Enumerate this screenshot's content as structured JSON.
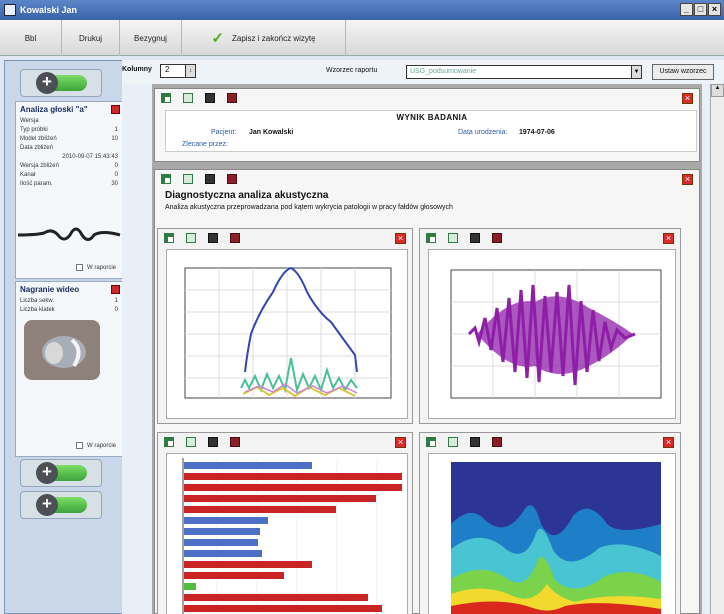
{
  "window": {
    "title": "Kowalski Jan",
    "controls": [
      "_",
      "□",
      "×"
    ]
  },
  "toolbar": {
    "close": "Bbl",
    "print": "Drukuj",
    "report": "Bezygnuj",
    "save_close": "Zapisz i zakończ wizytę"
  },
  "sidebar": {
    "analysis_card": {
      "title": "Analiza głoski \"a\"",
      "rows": [
        {
          "label": "Wersja",
          "value": ""
        },
        {
          "label": "Typ próbki",
          "value": "1"
        },
        {
          "label": "Model zbliżeń",
          "value": "10"
        },
        {
          "label": "Data zbliżeń",
          "value": ""
        },
        {
          "label": "",
          "value": "2010-09-07 15:43:43"
        },
        {
          "label": "Wersja zbliżeń",
          "value": "0"
        },
        {
          "label": "Kanał",
          "value": "0"
        },
        {
          "label": "Ilość param.",
          "value": "30"
        }
      ],
      "report_toggle": "W raporcie"
    },
    "video_card": {
      "title": "Nagranie wideo",
      "rows": [
        {
          "label": "Liczba sekw.",
          "value": "1"
        },
        {
          "label": "Liczba klatek",
          "value": "0"
        }
      ],
      "report_toggle": "W raporcie"
    }
  },
  "controls": {
    "columns_label": "Kolumny",
    "columns_value": "2",
    "template_label": "Wzorzec raportu",
    "template_value": "USG_podsumowanie",
    "set_template": "Ustaw wzorzec"
  },
  "report": {
    "title": "WYNIK BADANIA",
    "patient_label": "Pacjent:",
    "patient_value": "Jan Kowalski",
    "birth_label": "Data urodzenia:",
    "birth_value": "1974-07-06",
    "ordered_by_label": "Zlecane przez:"
  },
  "diagnostics": {
    "title": "Diagnostyczna analiza akustyczna",
    "description": "Analiza akustyczna przeprowadzana pod kątem wykrycia patologii w pracy fałdów głosowych"
  },
  "colors": {
    "accent_blue": "#2f56a7",
    "accent_green": "#4fbf3e",
    "bar_red": "#c92323",
    "bar_blue": "#4d70c6",
    "wave_purple": "#8e1fa8"
  }
}
